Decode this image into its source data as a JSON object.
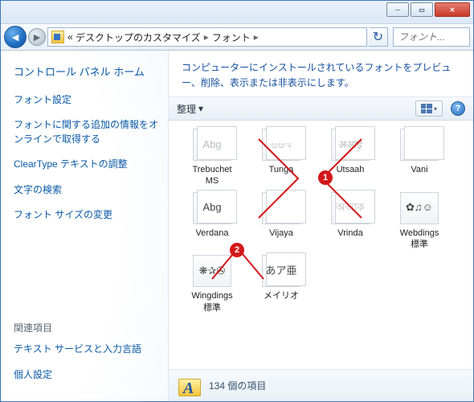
{
  "titlebar": {
    "min": "─",
    "max": "▭",
    "close": "✕"
  },
  "nav": {
    "back_glyph": "◄",
    "fwd_glyph": "►",
    "crumb_prefix": "«",
    "crumb1": "デスクトップのカスタマイズ",
    "crumb2": "フォント",
    "sep_glyph": "▸",
    "refresh_glyph": "↻",
    "search_placeholder": "フォント..."
  },
  "sidebar": {
    "home": "コントロール パネル ホーム",
    "links": [
      "フォント設定",
      "フォントに関する追加の情報をオンラインで取得する",
      "ClearType テキストの調整",
      "文字の検索",
      "フォント サイズの変更"
    ],
    "related_heading": "関連項目",
    "related": [
      "テキスト サービスと入力言語",
      "個人設定"
    ]
  },
  "main": {
    "description": "コンピューターにインストールされているフォントをプレビュー、削除、表示または非表示にします。",
    "arrange_label": "整理",
    "arrange_arrow": "▾",
    "view_arrow": "▾",
    "help_glyph": "?"
  },
  "fonts": [
    {
      "label": "Trebuchet\nMS",
      "sample": "Abg",
      "stack": true,
      "active": false
    },
    {
      "label": "Tunga",
      "sample": "ಅಆಇ",
      "stack": true,
      "active": false
    },
    {
      "label": "Utsaah",
      "sample": "अआइ",
      "stack": true,
      "active": false
    },
    {
      "label": "Vani",
      "sample": "",
      "stack": true,
      "active": false
    },
    {
      "label": "Verdana",
      "sample": "Abg",
      "stack": true,
      "active": true
    },
    {
      "label": "Vijaya",
      "sample": "",
      "stack": true,
      "active": false
    },
    {
      "label": "Vrinda",
      "sample": "অআক",
      "stack": true,
      "active": false
    },
    {
      "label": "Webdings\n標準",
      "sample": "✿♫☺",
      "stack": false,
      "active": true
    },
    {
      "label": "Wingdings\n標準",
      "sample": "❋✰✇",
      "stack": false,
      "active": true
    },
    {
      "label": "メイリオ",
      "sample": "あア亜",
      "stack": true,
      "active": true
    }
  ],
  "status": {
    "count_text": "134 個の項目"
  },
  "annotations": {
    "badge1": "1",
    "badge2": "2"
  }
}
